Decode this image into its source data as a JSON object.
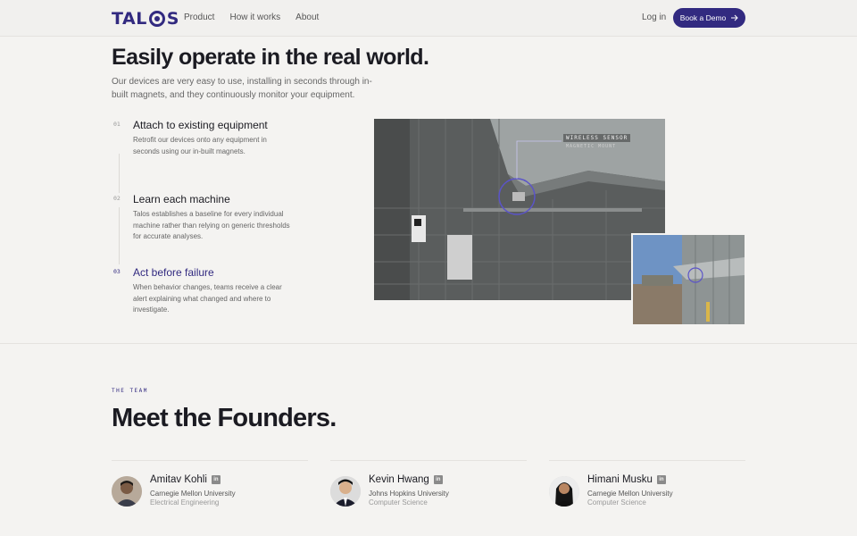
{
  "nav": {
    "logo_text": "TALOS",
    "links": [
      "Product",
      "How it works",
      "About"
    ],
    "login": "Log in",
    "cta": "Book a Demo",
    "cta_icon": "arrow-right-icon"
  },
  "hero": {
    "title": "Easily operate in the real world.",
    "subtitle": "Our devices are very easy to use, installing in seconds through in-built magnets, and they continuously monitor your equipment."
  },
  "steps": [
    {
      "num": "01",
      "title": "Attach to existing equipment",
      "desc": "Retrofit our devices onto any equipment in seconds using our in-built magnets."
    },
    {
      "num": "02",
      "title": "Learn each machine",
      "desc": "Talos establishes a baseline for every individual machine rather than relying on generic thresholds for accurate analyses."
    },
    {
      "num": "03",
      "title": "Act before failure",
      "desc": "When behavior changes, teams receive a clear alert explaining what changed and where to investigate."
    }
  ],
  "photo": {
    "label_1": "WIRELESS SENSOR",
    "label_2": "MAGNETIC MOUNT"
  },
  "team": {
    "eyebrow": "THE TEAM",
    "title": "Meet the Founders.",
    "founders": [
      {
        "name": "Amitav Kohli",
        "school": "Carnegie Mellon University",
        "dept": "Electrical Engineering"
      },
      {
        "name": "Kevin Hwang",
        "school": "Johns Hopkins University",
        "dept": "Computer Science"
      },
      {
        "name": "Himani Musku",
        "school": "Carnegie Mellon University",
        "dept": "Computer Science"
      }
    ]
  },
  "colors": {
    "accent": "#322a80",
    "background": "#f4f3f1"
  }
}
